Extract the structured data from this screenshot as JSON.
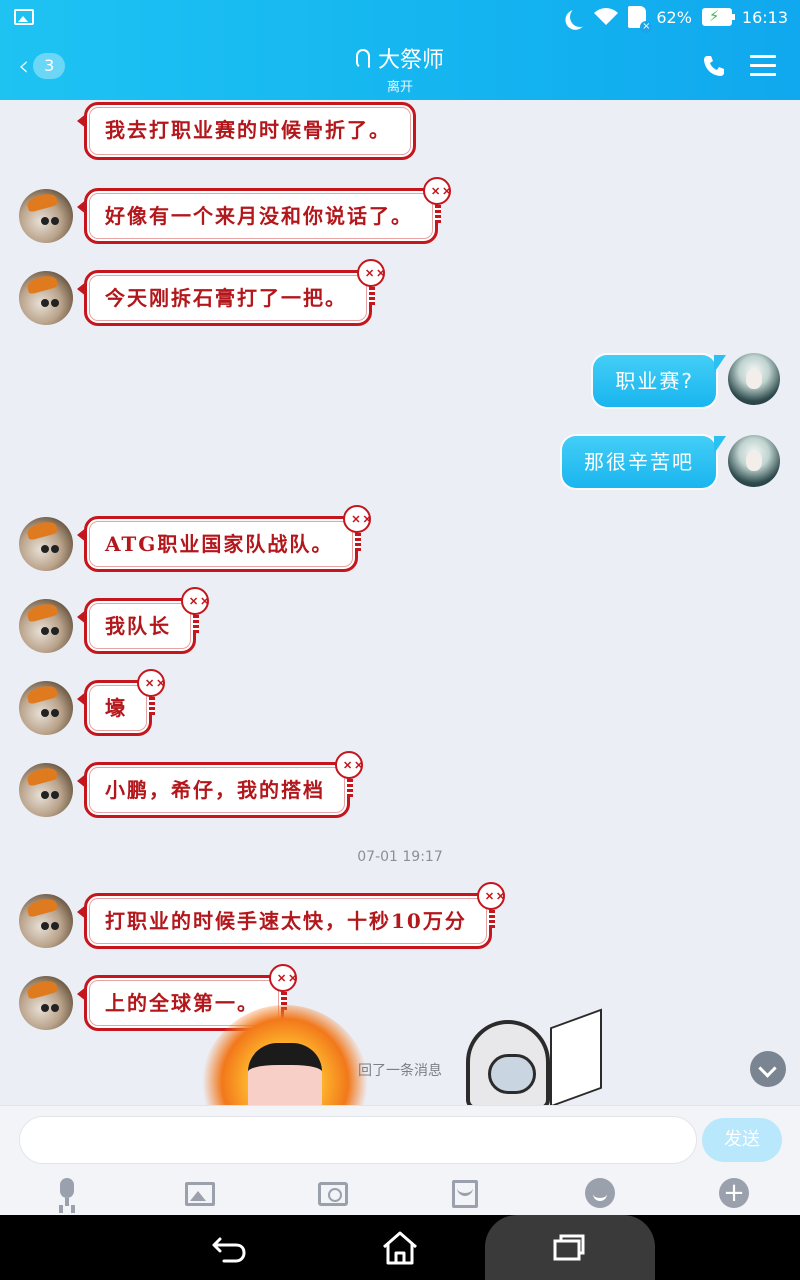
{
  "status_bar": {
    "battery": "62%",
    "time": "16:13",
    "icons": [
      "gallery-icon",
      "moon-icon",
      "wifi-icon",
      "sdcard-icon",
      "battery-charging-icon"
    ]
  },
  "header": {
    "back_count": "3",
    "title": "大祭师",
    "subtitle": "离开"
  },
  "messages": [
    {
      "side": "left",
      "text": "我去打职业赛的时候骨折了。"
    },
    {
      "side": "left",
      "text": "好像有一个来月没和你说话了。"
    },
    {
      "side": "left",
      "text": "今天刚拆石膏打了一把。"
    },
    {
      "side": "right",
      "text": "职业赛?"
    },
    {
      "side": "right",
      "text": "那很辛苦吧"
    },
    {
      "side": "left",
      "text": "ATG职业国家队战队。"
    },
    {
      "side": "left",
      "text": "我队长"
    },
    {
      "side": "left",
      "text": "壕"
    },
    {
      "side": "left",
      "text": "小鹏，希仔，我的搭档"
    },
    {
      "side": "left",
      "text": "打职业的时候手速太快，十秒10万分"
    },
    {
      "side": "left",
      "text": "上的全球第一。"
    }
  ],
  "timestamp": "07-01 19:17",
  "recall_notice": "回了一条消息",
  "input": {
    "placeholder": "",
    "value": "",
    "send_label": "发送"
  },
  "toolbar_icons": [
    "mic-icon",
    "image-icon",
    "camera-icon",
    "red-packet-icon",
    "emoji-icon",
    "plus-icon"
  ],
  "colors": {
    "header": "#14b4f0",
    "left_bubble_border": "#c4161c",
    "right_bubble": "#19b5ef",
    "background": "#eceef5"
  }
}
